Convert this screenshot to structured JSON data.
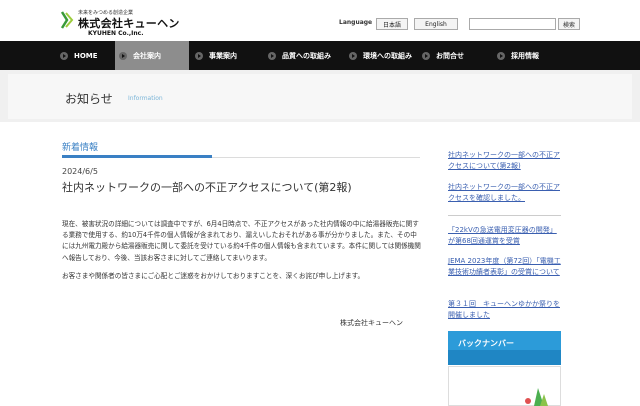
{
  "header": {
    "logo_tagline": "未来をみつめる創造企業",
    "logo_name": "株式会社キューヘン",
    "logo_en": "KYUHEN Co.,Inc.",
    "language_label": "Language",
    "lang_ja": "日本語",
    "lang_en": "English",
    "search_placeholder": "",
    "search_button": "検索"
  },
  "nav": [
    {
      "label": "HOME"
    },
    {
      "label": "会社案内"
    },
    {
      "label": "事業案内"
    },
    {
      "label": "品質への取組み"
    },
    {
      "label": "環境への取組み"
    },
    {
      "label": "お問合せ"
    },
    {
      "label": "採用情報"
    }
  ],
  "page": {
    "title": "お知らせ",
    "subtitle": "Information"
  },
  "main": {
    "section_heading": "新着情報",
    "date": "2024/6/5",
    "title": "社内ネットワークの一部への不正アクセスについて(第2報)",
    "body": [
      "現在、被害状況の詳細については調査中ですが、6月4日時点で、不正アクセスがあった社内情報の中に給湯器販売に関する業務で使用する、約10万4千件の個人情報が含まれており、漏えいしたおそれがある事が分かりました。また、その中には九州電力殿から給湯器販売に関して委託を受けている約4千件の個人情報も含まれています。本件に関しては関係機関へ報告しており、今後、当該お客さまに対してご連絡してまいります。",
      "お客さまや関係者の皆さまにご心配とご迷惑をおかけしておりますことを、深くお詫び申し上げます。"
    ],
    "signature": "株式会社キューヘン"
  },
  "sidebar": {
    "links": [
      {
        "text": "社内ネットワークの一部への不正アクセスについて(第2報)"
      },
      {
        "text": "社内ネットワークの一部への不正アクセスを確認しました。"
      },
      {
        "text": "「22kVの急送電用変圧器の開発」が第68回通運賞を受賞"
      },
      {
        "text": "JEMA 2023年度（第72回）「電機工業技術功績者表彰」の受賞について"
      },
      {
        "text": "第３１回　キューヘンゆかか祭りを開催しました"
      }
    ],
    "backnumber": "バックナンバー"
  },
  "colors": {
    "nav_bg": "#111111",
    "nav_active": "#8d8d8d",
    "accent_blue": "#3a80c4",
    "link": "#3a5fb0",
    "backnumber_bg": "#2c9bd9"
  }
}
